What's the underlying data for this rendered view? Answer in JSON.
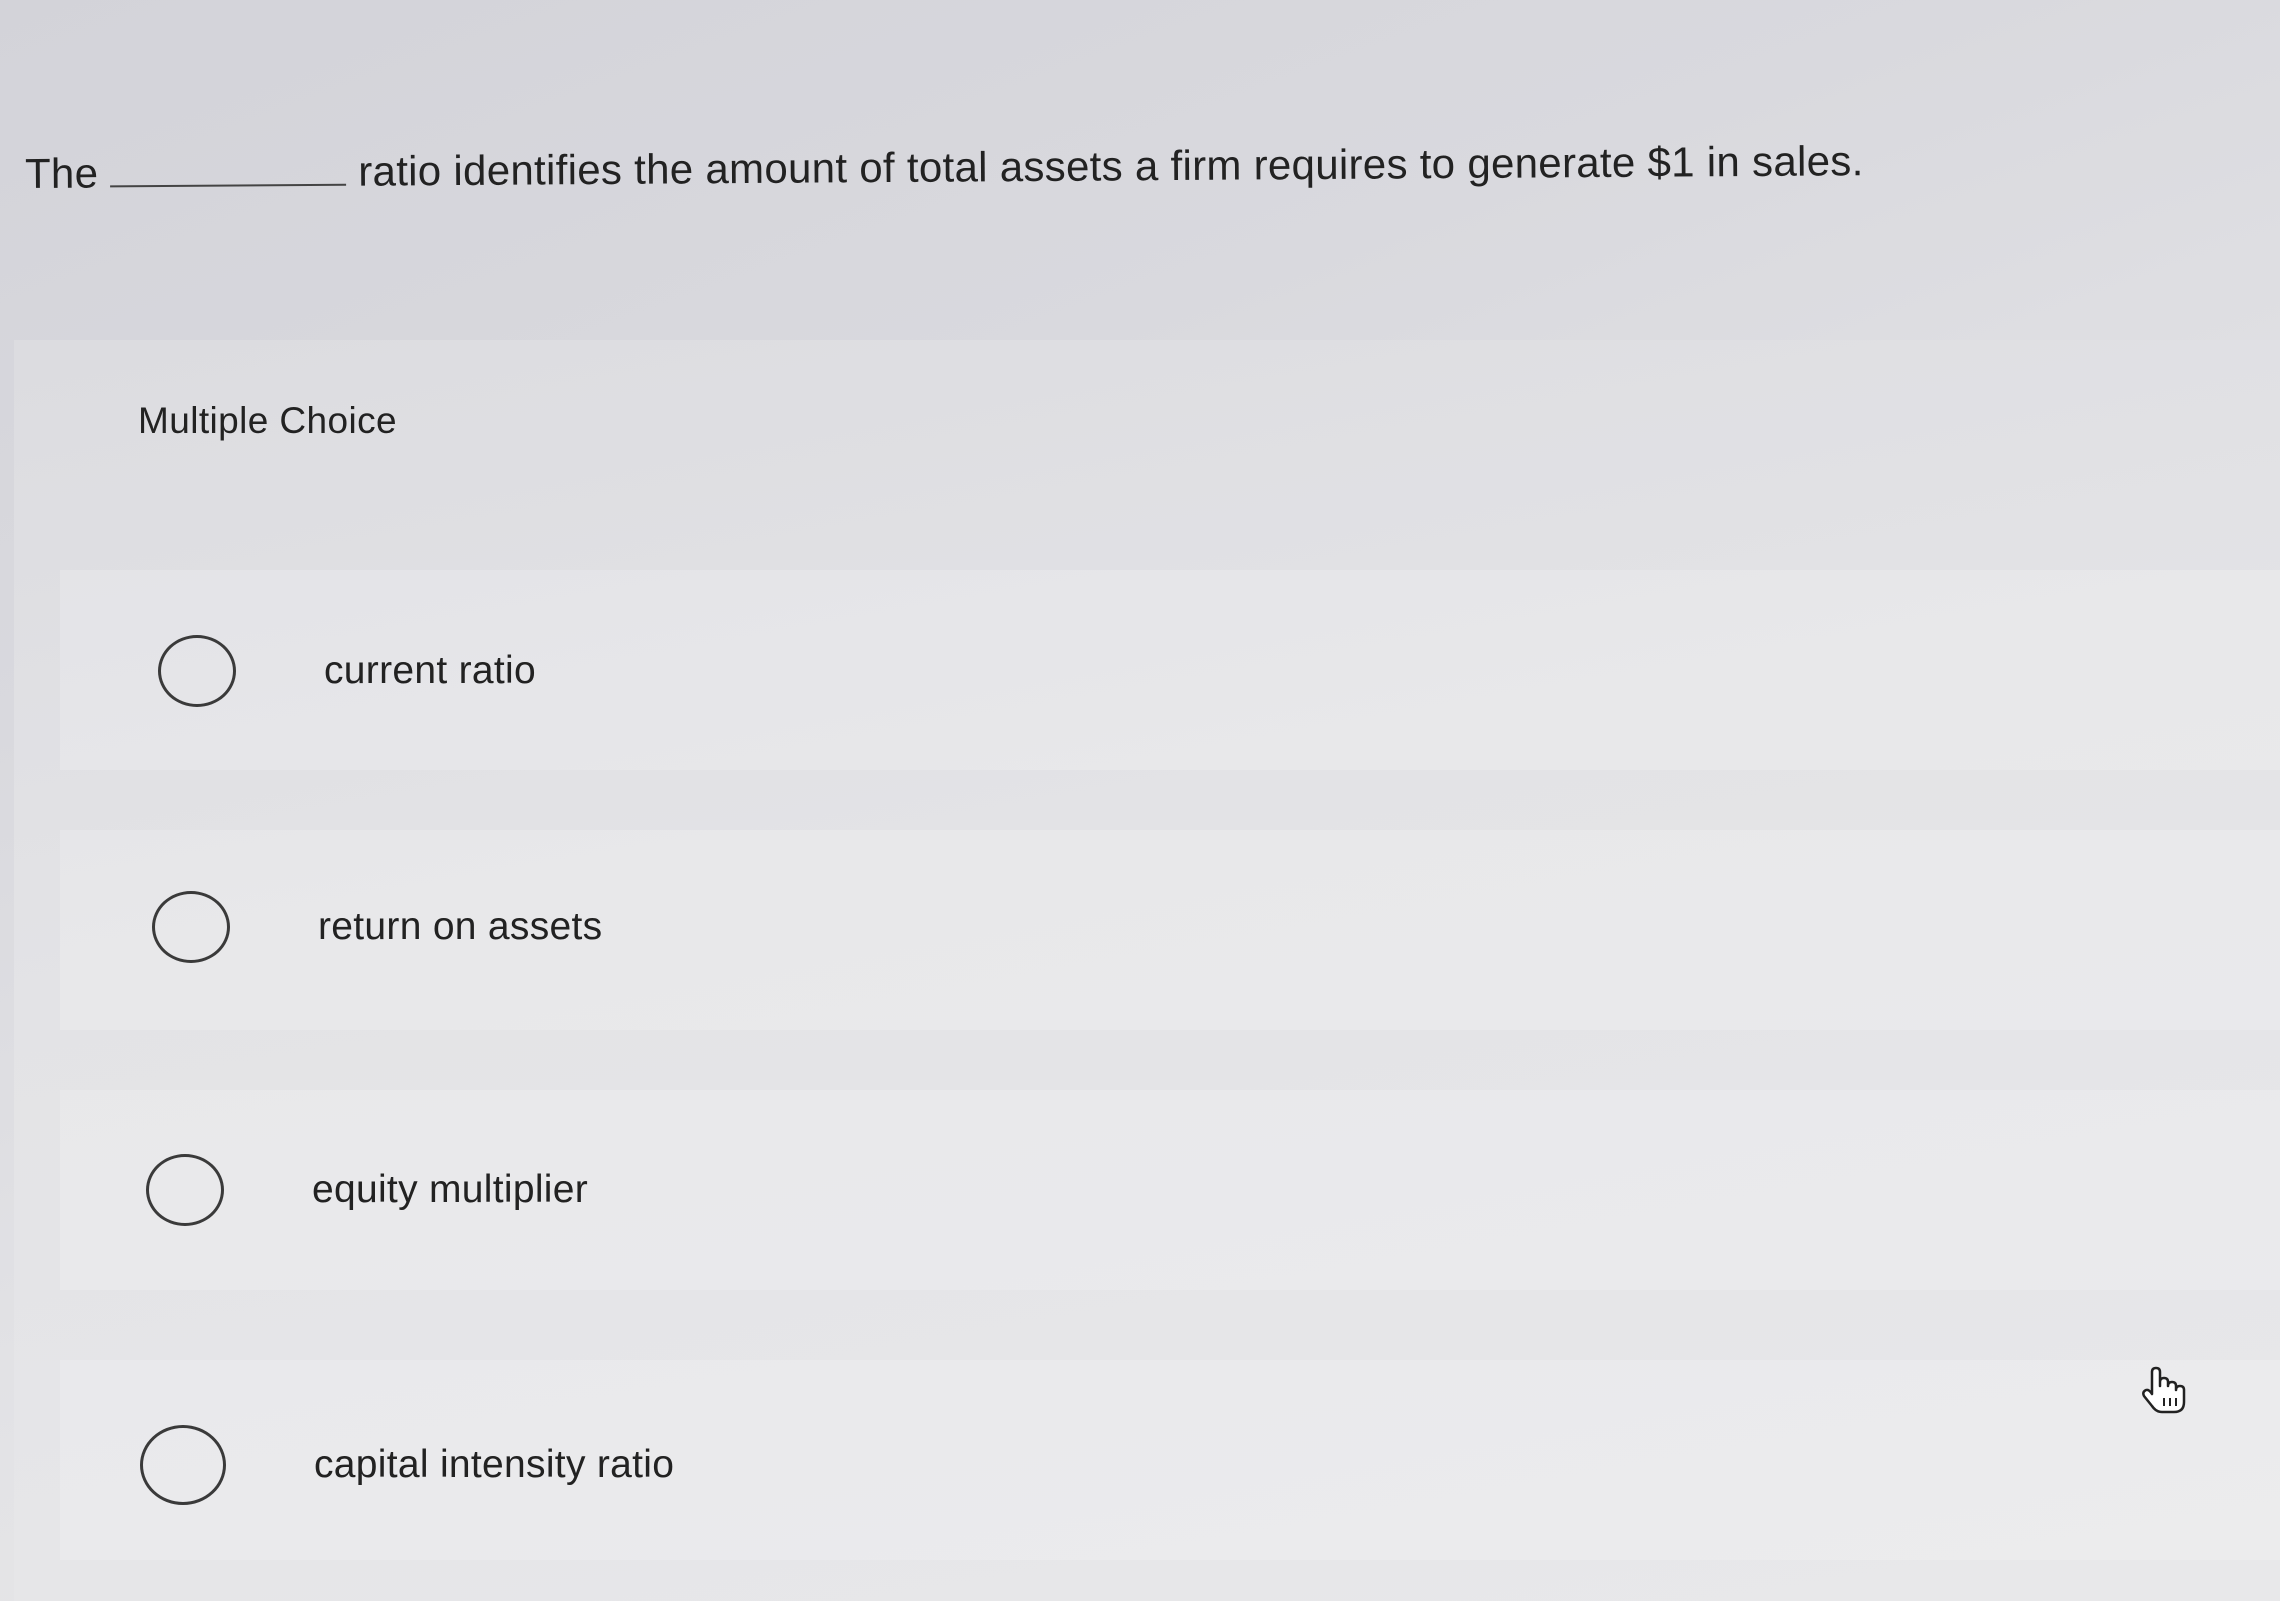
{
  "question": {
    "prefix": "The",
    "suffix": "ratio identifies the amount of total assets a firm requires to generate $1 in sales."
  },
  "section": {
    "label": "Multiple Choice"
  },
  "options": [
    {
      "label": "current ratio"
    },
    {
      "label": "return on assets"
    },
    {
      "label": "equity multiplier"
    },
    {
      "label": "capital intensity ratio"
    }
  ],
  "cursor": {
    "icon": "hand-pointer-icon"
  }
}
